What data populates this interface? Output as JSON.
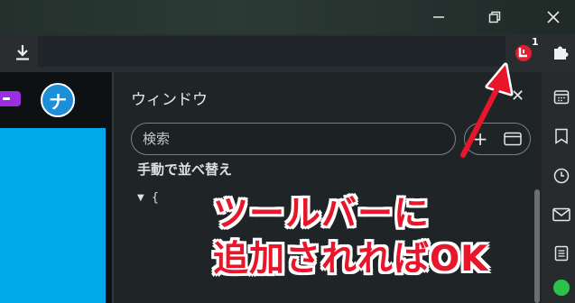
{
  "window": {
    "minimize_icon": "minimize-icon",
    "restore_icon": "restore-icon",
    "close_icon": "close-icon"
  },
  "toolbar": {
    "download_icon": "download-icon",
    "extension_badge_count": "1",
    "extensions_icon": "puzzle-icon"
  },
  "panel": {
    "title": "ウィンドウ",
    "search_placeholder": "検索",
    "add_label": "+",
    "sort_label": "手動で並べ替え",
    "tree_row": "{"
  },
  "annotation": {
    "line1": "ツールバーに",
    "line2": "追加されればOK",
    "color": "#e8162a"
  },
  "avatar": {
    "letter": "ナ"
  },
  "colors": {
    "page_blue": "#00a8ec",
    "pill_purple": "#9b2ee0",
    "status_green": "#2bc24a"
  }
}
